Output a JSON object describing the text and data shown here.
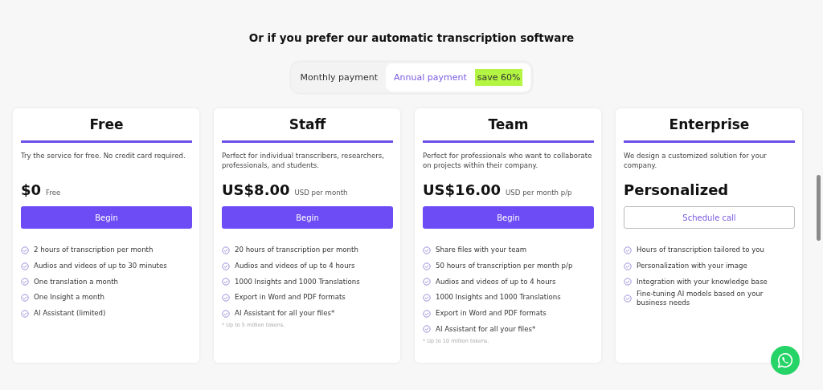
{
  "heading": "Or if you prefer our automatic transcription software",
  "billing_toggle": {
    "options": [
      {
        "label": "Monthly payment",
        "selected": false
      },
      {
        "label": "Annual payment",
        "selected": true,
        "badge": "save 60%"
      }
    ]
  },
  "plans": [
    {
      "name": "Free",
      "description": "Try the service for free. No credit card required.",
      "price": "$0",
      "price_note": "Free",
      "button": {
        "label": "Begin",
        "kind": "filled"
      },
      "features": [
        "2 hours of transcription per month",
        "Audios and videos of up to 30 minutes",
        "One translation a month",
        "One Insight a month",
        "AI Assistant (limited)"
      ]
    },
    {
      "name": "Staff",
      "description": "Perfect for individual transcribers, researchers, professionals, and students.",
      "price": "US$8.00",
      "price_note": "USD per month",
      "button": {
        "label": "Begin",
        "kind": "filled"
      },
      "features": [
        "20 hours of transcription per month",
        "Audios and videos of up to 4 hours",
        "1000 Insights and 1000 Translations",
        "Export in Word and PDF formats",
        "AI Assistant for all your files*"
      ],
      "footnote": "* Up to 5 million tokens."
    },
    {
      "name": "Team",
      "description": "Perfect for professionals who want to collaborate on projects within their company.",
      "price": "US$16.00",
      "price_note": "USD per month p/p",
      "button": {
        "label": "Begin",
        "kind": "filled"
      },
      "features": [
        "Share files with your team",
        "50 hours of transcription per month p/p",
        "Audios and videos of up to 4 hours",
        "1000 Insights and 1000 Translations",
        "Export in Word and PDF formats",
        "AI Assistant for all your files*"
      ],
      "footnote": "* Up to 10 million tokens."
    },
    {
      "name": "Enterprise",
      "description": "We design a customized solution for your company.",
      "price": "Personalized",
      "button": {
        "label": "Schedule call",
        "kind": "outline"
      },
      "features": [
        "Hours of transcription tailored to you",
        "Personalization with your image",
        "Integration with your knowledge base",
        "Fine-tuning AI models based on your business needs"
      ]
    }
  ]
}
